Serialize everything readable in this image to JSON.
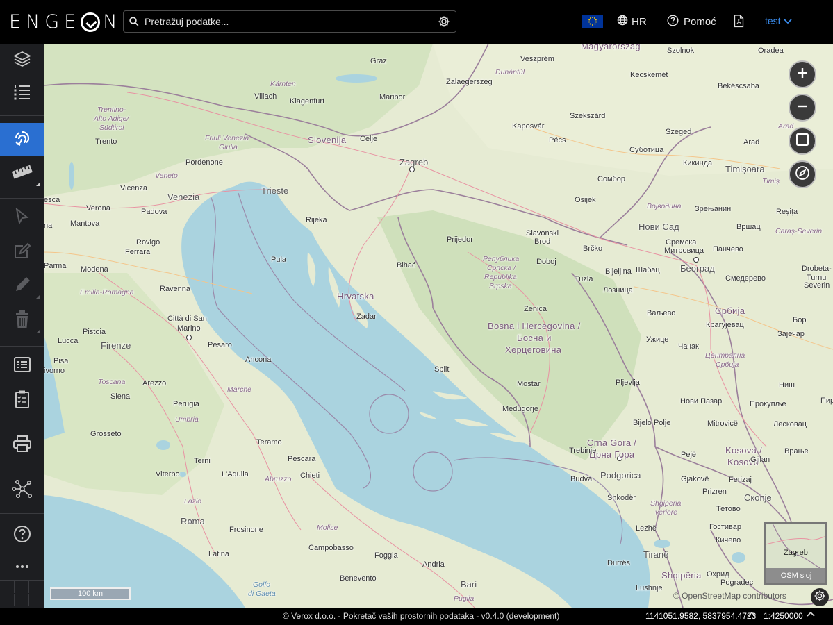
{
  "header": {
    "logo_text": "ENGE",
    "logo_text_end": "N",
    "search": {
      "placeholder": "Pretražuj podatke...",
      "value": ""
    },
    "language": "HR",
    "help_label": "Pomoć",
    "user_label": "test"
  },
  "sidebar": {
    "items": [
      {
        "name": "layers-icon"
      },
      {
        "name": "legend-list-icon"
      },
      {
        "name": "identify-icon",
        "active": true
      },
      {
        "name": "measure-ruler-icon"
      },
      {
        "name": "select-pointer-icon"
      },
      {
        "name": "edit-icon"
      },
      {
        "name": "draw-pencil-icon"
      },
      {
        "name": "delete-trash-icon"
      },
      {
        "name": "attribute-table-icon"
      },
      {
        "name": "task-clipboard-icon"
      },
      {
        "name": "print-icon"
      },
      {
        "name": "network-icon"
      },
      {
        "name": "help-icon"
      },
      {
        "name": "more-icon"
      }
    ]
  },
  "map": {
    "labels": {
      "graz": "Graz",
      "maribor": "Maribor",
      "zalaegerszeg": "Zalaegerszeg",
      "veszprem": "Veszprém",
      "szekesf": "Székesfehérvár",
      "magyarorszag": "Magyarország",
      "szolnok": "Szolnok",
      "oradea": "Oradea",
      "kecskemet": "Kecskemét",
      "bekescsaba": "Békéscsaba",
      "dunantul": "Dunántúl",
      "karnten": "Kärnten",
      "villach": "Villach",
      "klagenfurt": "Klagenfurt",
      "trentino": "Trentino-",
      "trentino2": "Alto Adige/",
      "trentino3": "Südtirol",
      "trento": "Trento",
      "friuli": "Friuli Venezia",
      "friuli2": "Giulia",
      "slovenija": "Slovenija",
      "celje": "Celje",
      "zagreb": "Zagreb",
      "kaposvar": "Kaposvár",
      "szekszard": "Szekszárd",
      "pecs": "Pécs",
      "arad_region": "Arad",
      "szeged": "Szeged",
      "subotica": "Суботица",
      "kikinda": "Кикинда",
      "arad": "Arad",
      "timisoara": "Timișoara",
      "timis": "Timiș",
      "pordenone": "Pordenone",
      "veneto": "Veneto",
      "sombor": "Сомбор",
      "osijek": "Osijek",
      "vojvodina": "Војводина",
      "zrenjanin": "Зрењанин",
      "resita": "Reșița",
      "verona": "Verona",
      "vicenza": "Vicenza",
      "venezia": "Venezia",
      "trieste": "Trieste",
      "padova": "Padova",
      "rijeka": "Rijeka",
      "mantova": "Mantova",
      "prijedor": "Prijedor",
      "slavonski": "Slavonski",
      "slavonski2": "Brod",
      "brcko": "Brčko",
      "novisad": "Нови Сад",
      "vrsac": "Вршац",
      "caras": "Caraș-Severin",
      "rovigo": "Rovigo",
      "pula": "Pula",
      "bihac": "Bihać",
      "republika": "Република",
      "republika2": "Српска /",
      "republika3": "Republika",
      "republika4": "Srpska",
      "doboj": "Doboj",
      "sremska": "Сремска",
      "sremska2": "Митровица",
      "pancevo": "Панчево",
      "drobeta": "Drobeta-",
      "drobeta2": "Turnu",
      "drobeta3": "Severin",
      "parma": "Parma",
      "modena": "Modena",
      "ferrara": "Ferrara",
      "bijeljina": "Bijeljina",
      "sabac": "Шабац",
      "beograd": "Београд",
      "smederevo": "Смедерево",
      "ravenna": "Ravenna",
      "hrvatska": "Hrvatska",
      "tuzla": "Tuzla",
      "loznica": "Лозница",
      "emilia": "Emilia-Romagna",
      "zadar": "Zadar",
      "zenica": "Zenica",
      "valjevo": "Ваљево",
      "srbija": "Србија",
      "bor": "Бор",
      "bih1": "Bosna i Hercegovina /",
      "bih2": "Босна и",
      "bih3": "Херцеговина",
      "kragujevac": "Крагујевац",
      "citta": "Città di San",
      "citta2": "Marino",
      "lucca": "Lucca",
      "pistoia": "Pistoia",
      "pesaro": "Pesaro",
      "uzice": "Ужице",
      "cacak": "Чачак",
      "zajecar": "Зајечар",
      "firenze": "Firenze",
      "pisa": "Pisa",
      "ancona": "Ancona",
      "split": "Split",
      "centralna": "Централна",
      "centralna2": "Србија",
      "livorno": "Livorno",
      "toscana": "Toscana",
      "arezzo": "Arezzo",
      "marche": "Marche",
      "pljevlja": "Pljevlja",
      "mostar": "Mostar",
      "nis": "Ниш",
      "siena": "Siena",
      "perugia": "Perugia",
      "novipazar": "Нови Пазар",
      "prokuplje": "Прокупље",
      "pirot": "Пир",
      "medugorje": "Međugorje",
      "umbria": "Umbria",
      "bijelopolje": "Bijelo Polje",
      "mitrovice": "Mitrovicë",
      "leskovac": "Лесковац",
      "grosseto": "Grosseto",
      "teramo": "Teramo",
      "cg1": "Crna Gora /",
      "cg2": "Црна Гора",
      "trebinje": "Trebinje",
      "peje": "Pejë",
      "kosova1": "Kosova /",
      "kosova2": "Kosovo",
      "vranje": "Врање",
      "terni": "Terni",
      "pescara": "Pescara",
      "podgorica": "Podgorica",
      "gjilan": "Gjilan",
      "viterbo": "Viterbo",
      "laquila": "L'Aquila",
      "chieti": "Chieti",
      "budva": "Budva",
      "gjakove": "Gjakovë",
      "ferizaj": "Ferizaj",
      "abruzzo": "Abruzzo",
      "prizren": "Prizren",
      "lazio": "Lazio",
      "shkoder": "Shkodër",
      "skopje": "Скопје",
      "shqiperia": "Shqipëria",
      "shqiperia2": "veriore",
      "roma": "Roma",
      "tetovo": "Тетово",
      "lezhe": "Lezhë",
      "frosinone": "Frosinone",
      "molise": "Molise",
      "gostivar": "Гостивар",
      "ma": "Ма",
      "kicevo": "Кичево",
      "campobasso": "Campobasso",
      "tirane": "Tiranë",
      "latina": "Latina",
      "foggia": "Foggia",
      "durres": "Durrës",
      "ohrid": "Охрид",
      "shqiperia3": "Shqipëria",
      "pogradec": "Pogradec",
      "andria": "Andria",
      "benevento": "Benevento",
      "bari": "Bari",
      "golfo": "Golfo",
      "golfo2": "di Gaeta",
      "puglia": "Puglia",
      "lushnje": "Lushnje",
      "esca": "esca",
      "na": "na",
      "ivorno": "ivorno"
    },
    "overview_label": "Zagreb",
    "overview_layer_button": "OSM sloj",
    "scale_bar": "100 km",
    "attribution": "© OpenStreetMap contributors"
  },
  "footer": {
    "copyright": "© Verox d.o.o. - Pokretač vaših prostornih podataka - v0.4.0 (development)",
    "coordinates": "1141051.9582, 5837954.4723",
    "scale": "1:4250000"
  }
}
